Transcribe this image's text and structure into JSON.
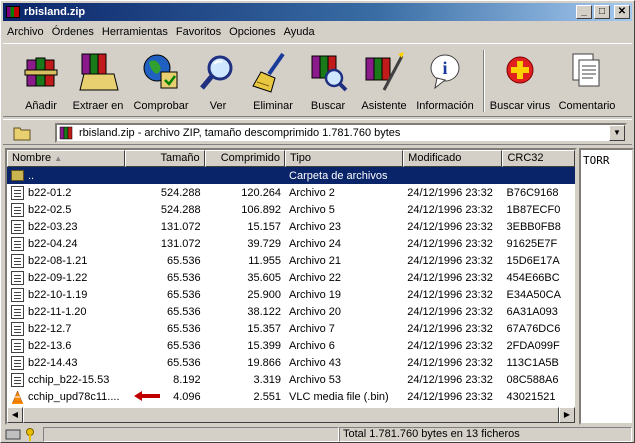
{
  "window": {
    "title": "rbisland.zip"
  },
  "titlebar": {
    "minimize": "_",
    "maximize": "□",
    "close": "✕"
  },
  "menu": [
    "Archivo",
    "Órdenes",
    "Herramientas",
    "Favoritos",
    "Opciones",
    "Ayuda"
  ],
  "toolbar": [
    {
      "label": "Añadir",
      "icon": "add-books-icon"
    },
    {
      "label": "Extraer en",
      "icon": "extract-folder-icon"
    },
    {
      "label": "Comprobar",
      "icon": "test-globe-icon"
    },
    {
      "label": "Ver",
      "icon": "view-magnifier-icon"
    },
    {
      "label": "Eliminar",
      "icon": "delete-broom-icon"
    },
    {
      "label": "Buscar",
      "icon": "find-books-icon"
    },
    {
      "label": "Asistente",
      "icon": "wizard-books-icon"
    },
    {
      "label": "Información",
      "icon": "info-icon"
    },
    {
      "label": "Buscar virus",
      "icon": "virus-scan-icon"
    },
    {
      "label": "Comentario",
      "icon": "comment-pages-icon"
    }
  ],
  "address": {
    "text": "rbisland.zip - archivo ZIP, tamaño descomprimido 1.781.760 bytes",
    "dropdown": "▼"
  },
  "columns": [
    "Nombre",
    "Tamaño",
    "Comprimido",
    "Tipo",
    "Modificado",
    "CRC32"
  ],
  "rows": [
    {
      "name": "..",
      "size": "",
      "comp": "",
      "type": "Carpeta de archivos",
      "mod": "",
      "crc": "",
      "icon": "folder-icon",
      "selected": true
    },
    {
      "name": "b22-01.2",
      "size": "524.288",
      "comp": "120.264",
      "type": "Archivo 2",
      "mod": "24/12/1996 23:32",
      "crc": "B76C9168",
      "icon": "file-icon"
    },
    {
      "name": "b22-02.5",
      "size": "524.288",
      "comp": "106.892",
      "type": "Archivo 5",
      "mod": "24/12/1996 23:32",
      "crc": "1B87ECF0",
      "icon": "file-icon"
    },
    {
      "name": "b22-03.23",
      "size": "131.072",
      "comp": "15.157",
      "type": "Archivo 23",
      "mod": "24/12/1996 23:32",
      "crc": "3EBB0FB8",
      "icon": "file-icon"
    },
    {
      "name": "b22-04.24",
      "size": "131.072",
      "comp": "39.729",
      "type": "Archivo 24",
      "mod": "24/12/1996 23:32",
      "crc": "91625E7F",
      "icon": "file-icon"
    },
    {
      "name": "b22-08-1.21",
      "size": "65.536",
      "comp": "11.955",
      "type": "Archivo 21",
      "mod": "24/12/1996 23:32",
      "crc": "15D6E17A",
      "icon": "file-icon"
    },
    {
      "name": "b22-09-1.22",
      "size": "65.536",
      "comp": "35.605",
      "type": "Archivo 22",
      "mod": "24/12/1996 23:32",
      "crc": "454E66BC",
      "icon": "file-icon"
    },
    {
      "name": "b22-10-1.19",
      "size": "65.536",
      "comp": "25.900",
      "type": "Archivo 19",
      "mod": "24/12/1996 23:32",
      "crc": "E34A50CA",
      "icon": "file-icon"
    },
    {
      "name": "b22-11-1.20",
      "size": "65.536",
      "comp": "38.122",
      "type": "Archivo 20",
      "mod": "24/12/1996 23:32",
      "crc": "6A31A093",
      "icon": "file-icon"
    },
    {
      "name": "b22-12.7",
      "size": "65.536",
      "comp": "15.357",
      "type": "Archivo 7",
      "mod": "24/12/1996 23:32",
      "crc": "67A76DC6",
      "icon": "file-icon"
    },
    {
      "name": "b22-13.6",
      "size": "65.536",
      "comp": "15.399",
      "type": "Archivo 6",
      "mod": "24/12/1996 23:32",
      "crc": "2FDA099F",
      "icon": "file-icon"
    },
    {
      "name": "b22-14.43",
      "size": "65.536",
      "comp": "19.866",
      "type": "Archivo 43",
      "mod": "24/12/1996 23:32",
      "crc": "113C1A5B",
      "icon": "file-icon"
    },
    {
      "name": "cchip_b22-15.53",
      "size": "8.192",
      "comp": "3.319",
      "type": "Archivo 53",
      "mod": "24/12/1996 23:32",
      "crc": "08C588A6",
      "icon": "file-icon"
    },
    {
      "name": "cchip_upd78c11....",
      "size": "4.096",
      "comp": "2.551",
      "type": "VLC media file (.bin)",
      "mod": "24/12/1996 23:32",
      "crc": "43021521",
      "icon": "vlc-cone-icon"
    }
  ],
  "rightpane": {
    "text": "TORR"
  },
  "status": {
    "left": "",
    "right": "Total 1.781.760 bytes en 13 ficheros"
  },
  "colors": {
    "title_start": "#0a246a",
    "title_end": "#a6caf0",
    "selection": "#0a246a",
    "arrow": "#c00000"
  }
}
